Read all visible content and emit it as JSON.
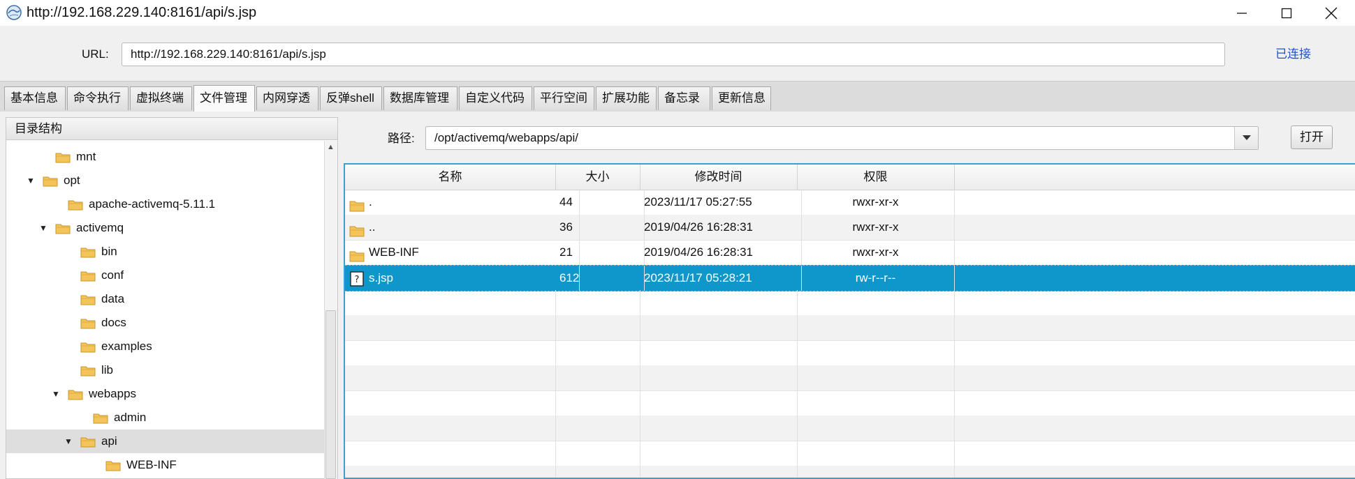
{
  "window": {
    "title": "http://192.168.229.140:8161/api/s.jsp",
    "icon": "globe-app-icon"
  },
  "urlbar": {
    "label": "URL:",
    "value": "http://192.168.229.140:8161/api/s.jsp",
    "status": "已连接",
    "status_color": "#1e50d0"
  },
  "tabs": [
    {
      "label": "基本信息"
    },
    {
      "label": "命令执行"
    },
    {
      "label": "虚拟终端"
    },
    {
      "label": "文件管理",
      "active": true
    },
    {
      "label": "内网穿透"
    },
    {
      "label": "反弹shell"
    },
    {
      "label": "数据库管理"
    },
    {
      "label": "自定义代码"
    },
    {
      "label": "平行空间"
    },
    {
      "label": "扩展功能"
    },
    {
      "label": "备忘录"
    },
    {
      "label": "更新信息"
    }
  ],
  "tree": {
    "header": "目录结构",
    "items": [
      {
        "label": "mnt",
        "depth": 2,
        "toggle": "",
        "selected": false
      },
      {
        "label": "opt",
        "depth": 1,
        "toggle": "▼",
        "selected": false
      },
      {
        "label": "apache-activemq-5.11.1",
        "depth": 3,
        "toggle": "",
        "selected": false
      },
      {
        "label": "activemq",
        "depth": 2,
        "toggle": "▼",
        "selected": false
      },
      {
        "label": "bin",
        "depth": 4,
        "toggle": "",
        "selected": false
      },
      {
        "label": "conf",
        "depth": 4,
        "toggle": "",
        "selected": false
      },
      {
        "label": "data",
        "depth": 4,
        "toggle": "",
        "selected": false
      },
      {
        "label": "docs",
        "depth": 4,
        "toggle": "",
        "selected": false
      },
      {
        "label": "examples",
        "depth": 4,
        "toggle": "",
        "selected": false
      },
      {
        "label": "lib",
        "depth": 4,
        "toggle": "",
        "selected": false
      },
      {
        "label": "webapps",
        "depth": 3,
        "toggle": "▼",
        "selected": false
      },
      {
        "label": "admin",
        "depth": 5,
        "toggle": "",
        "selected": false
      },
      {
        "label": "api",
        "depth": 4,
        "toggle": "▼",
        "selected": true
      },
      {
        "label": "WEB-INF",
        "depth": 6,
        "toggle": "",
        "selected": false
      }
    ]
  },
  "path": {
    "label": "路径:",
    "value": "/opt/activemq/webapps/api/",
    "open_label": "打开"
  },
  "table": {
    "columns": [
      "名称",
      "大小",
      "修改时间",
      "权限"
    ],
    "rows": [
      {
        "icon": "folder-icon",
        "name": ".",
        "size": "44",
        "mtime": "2023/11/17 05:27:55",
        "perm": "rwxr-xr-x",
        "selected": false
      },
      {
        "icon": "folder-icon",
        "name": "..",
        "size": "36",
        "mtime": "2019/04/26 16:28:31",
        "perm": "rwxr-xr-x",
        "selected": false
      },
      {
        "icon": "folder-icon",
        "name": "WEB-INF",
        "size": "21",
        "mtime": "2019/04/26 16:28:31",
        "perm": "rwxr-xr-x",
        "selected": false
      },
      {
        "icon": "unknown-file-icon",
        "name": "s.jsp",
        "size": "612",
        "mtime": "2023/11/17 05:28:21",
        "perm": "rw-r--r--",
        "selected": true
      }
    ]
  },
  "colors": {
    "selection": "#0f97cb",
    "focus_border": "#3a9fd6",
    "folder": "#f2c45a"
  }
}
